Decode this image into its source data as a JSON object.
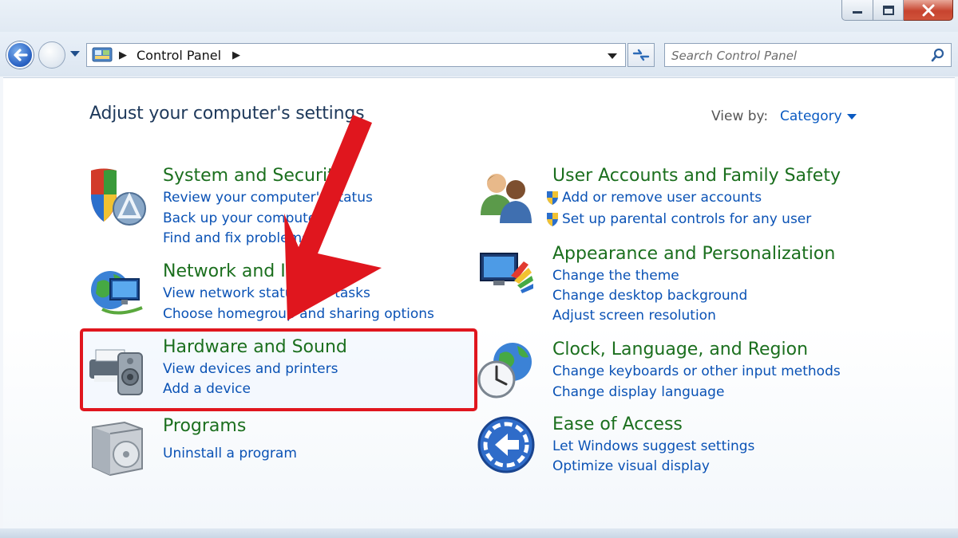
{
  "window": {
    "controls": [
      "minimize",
      "maximize",
      "close"
    ]
  },
  "address_bar": {
    "path": "Control Panel"
  },
  "search": {
    "placeholder": "Search Control Panel"
  },
  "page": {
    "title": "Adjust your computer's settings",
    "view_by_label": "View by:",
    "view_by_value": "Category"
  },
  "categories": [
    {
      "title": "System and Security",
      "icon": "shield-icon",
      "links": [
        "Review your computer's status",
        "Back up your computer",
        "Find and fix problems"
      ]
    },
    {
      "title": "Network and Internet",
      "icon": "network-globe-icon",
      "links": [
        "View network status and tasks",
        "Choose homegroup and sharing options"
      ]
    },
    {
      "title": "Hardware and Sound",
      "icon": "printer-speaker-icon",
      "links": [
        "View devices and printers",
        "Add a device"
      ]
    },
    {
      "title": "Programs",
      "icon": "programs-box-icon",
      "links": [
        "Uninstall a program"
      ]
    },
    {
      "title": "User Accounts and Family Safety",
      "icon": "users-icon",
      "links": [
        "Add or remove user accounts",
        "Set up parental controls for any user"
      ]
    },
    {
      "title": "Appearance and Personalization",
      "icon": "monitor-palette-icon",
      "links": [
        "Change the theme",
        "Change desktop background",
        "Adjust screen resolution"
      ]
    },
    {
      "title": "Clock, Language, and Region",
      "icon": "clock-globe-icon",
      "links": [
        "Change keyboards or other input methods",
        "Change display language"
      ]
    },
    {
      "title": "Ease of Access",
      "icon": "ease-of-access-icon",
      "links": [
        "Let Windows suggest settings",
        "Optimize visual display"
      ]
    }
  ],
  "annotation": {
    "highlight_color": "#e0161e",
    "arrow_color": "#e0161e"
  }
}
